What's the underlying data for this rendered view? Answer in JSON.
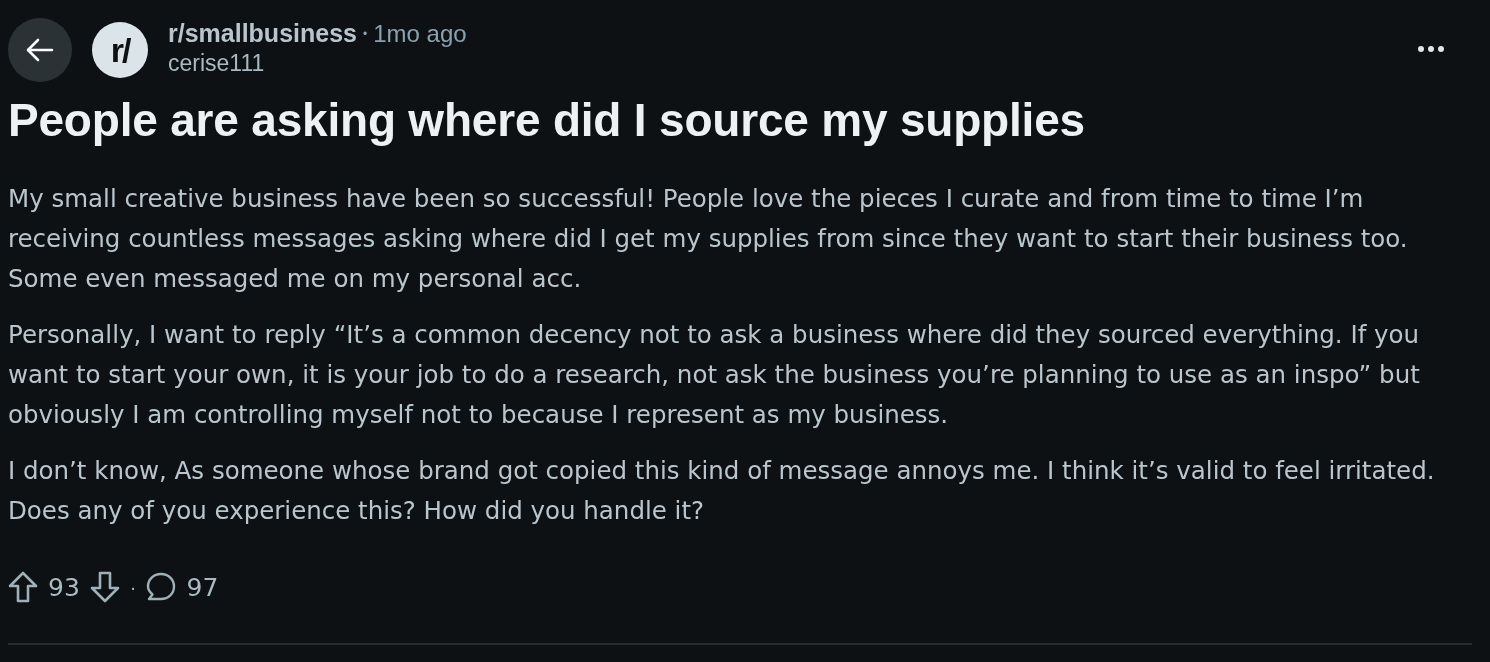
{
  "post": {
    "avatar_text": "r/",
    "subreddit": "r/smallbusiness",
    "separator": "•",
    "age": "1mo ago",
    "author": "cerise111",
    "title": "People are asking where did I source my supplies",
    "paragraphs": [
      "My small creative business have been so successful! People love the pieces I curate and from time to time I’m receiving countless messages asking where did I get my supplies from since they want to start their business too. Some even messaged me on my personal acc.",
      "Personally, I want to reply “It’s a common decency not to ask a business where did they sourced everything. If you want to start your own, it is your job to do a research, not ask the business you’re planning to use as an inspo” but obviously I am controlling myself not to because I represent as my business.",
      "I don’t know, As someone whose brand got copied this kind of message annoys me. I think it’s valid to feel irritated. Does any of you experience this? How did you handle it?"
    ]
  },
  "actions": {
    "upvotes": "93",
    "separator": "·",
    "comments": "97"
  }
}
